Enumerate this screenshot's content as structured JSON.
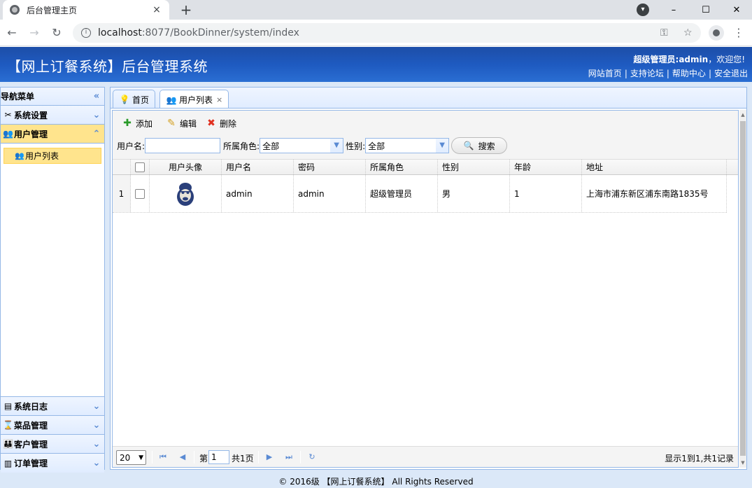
{
  "browser": {
    "tab_title": "后台管理主页",
    "tab_close": "×",
    "new_tab": "+",
    "url_host": "localhost",
    "url_rest": ":8077/BookDinner/system/index",
    "win_min": "–",
    "win_max": "☐",
    "win_close": "✕"
  },
  "header": {
    "title": "【网上订餐系统】后台管理系统",
    "welcome_bold": "超级管理员:admin",
    "welcome_rest": "，欢迎您!",
    "links": [
      "网站首页",
      "支持论坛",
      "帮助中心",
      "安全退出"
    ],
    "link_sep": "|"
  },
  "sidebar": {
    "title": "导航菜单",
    "groups_top": [
      {
        "label": "系统设置",
        "icon": "tools-icon"
      },
      {
        "label": "用户管理",
        "icon": "users-icon"
      }
    ],
    "active_item": "用户列表",
    "groups_bottom": [
      {
        "label": "系统日志",
        "icon": "log-icon"
      },
      {
        "label": "菜品管理",
        "icon": "hourglass-icon"
      },
      {
        "label": "客户管理",
        "icon": "customers-icon"
      },
      {
        "label": "订单管理",
        "icon": "order-icon"
      }
    ]
  },
  "tabs": [
    {
      "label": "首页"
    },
    {
      "label": "用户列表",
      "close": "×"
    }
  ],
  "toolbar": {
    "add": "添加",
    "edit": "编辑",
    "delete": "删除"
  },
  "filter": {
    "username_label": "用户名:",
    "username_value": "",
    "role_label": "所属角色:",
    "role_value": "全部",
    "gender_label": "性别:",
    "gender_value": "全部",
    "search": "搜索"
  },
  "grid": {
    "columns": [
      "用户头像",
      "用户名",
      "密码",
      "所属角色",
      "性别",
      "年龄",
      "地址"
    ],
    "rows": [
      {
        "num": "1",
        "username": "admin",
        "password": "admin",
        "role": "超级管理员",
        "gender": "男",
        "age": "1",
        "address": "上海市浦东新区浦东南路1835号"
      }
    ]
  },
  "pager": {
    "page_size": "20",
    "page_prefix": "第",
    "page_value": "1",
    "page_total": "共1页",
    "info": "显示1到1,共1记录"
  },
  "footer": {
    "text": "© 2016级 【网上订餐系统】 All Rights Reserved"
  },
  "colors": {
    "header_blue": "#1e5ac0",
    "panel_border": "#95b8e7",
    "active_yellow": "#ffe48d"
  }
}
